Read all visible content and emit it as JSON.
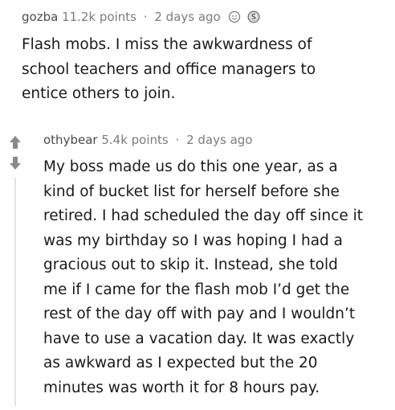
{
  "comment1": {
    "author": "gozba",
    "points": "11.2k points",
    "separator": "·",
    "age": "2 days ago",
    "body_lines": [
      "Flash mobs. I miss the awkwardness of",
      "school teachers and office managers to",
      "entice others to join."
    ]
  },
  "comment2": {
    "author": "othybear",
    "points": "5.4k points",
    "separator": "·",
    "age": "2 days ago",
    "body_lines": [
      "My boss made us do this one year, as a",
      "kind of bucket list for herself before she",
      "retired. I had scheduled the day off since it",
      "was my birthday so I was hoping I had a",
      "gracious out to skip it. Instead, she told",
      "me if I came for the flash mob I’d get the",
      "rest of the day off with pay and I wouldn’t",
      "have to use a vacation day. It was exactly",
      "as awkward as I expected but the 20",
      "minutes was worth it for 8 hours pay."
    ]
  },
  "icons": {
    "award_1": "smiley-award-icon",
    "award_2": "silver-coin-award-icon",
    "upvote": "upvote-arrow-icon",
    "downvote": "downvote-arrow-icon"
  },
  "colors": {
    "upvote": "#878a8c",
    "downvote": "#878a8c",
    "meta_text": "#7c7c7c",
    "body_text": "#1a1a1b"
  }
}
